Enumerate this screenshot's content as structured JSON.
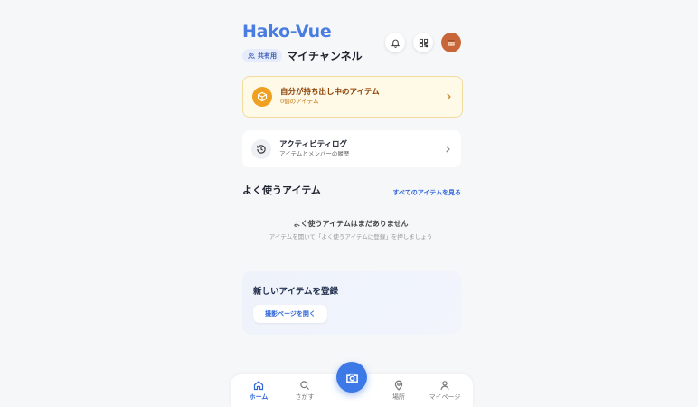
{
  "header": {
    "app_name": "Hako-Vue",
    "shared_badge": "共有用",
    "channel_name": "マイチャンネル"
  },
  "cards": {
    "carry_out": {
      "title": "自分が持ち出し中のアイテム",
      "subtitle": "0個のアイテム"
    },
    "activity_log": {
      "title": "アクティビティログ",
      "subtitle": "アイテムとメンバーの履歴"
    }
  },
  "frequent": {
    "title": "よく使うアイテム",
    "see_all": "すべてのアイテムを見る",
    "empty_title": "よく使うアイテムはまだありません",
    "empty_hint": "アイテムを開いて「よく使うアイテムに登録」を押しましょう"
  },
  "register": {
    "title": "新しいアイテムを登録",
    "button": "撮影ページを開く"
  },
  "tabbar": {
    "items": [
      {
        "label": "ホーム",
        "icon": "home-icon",
        "active": true
      },
      {
        "label": "さがす",
        "icon": "search-icon",
        "active": false
      },
      {
        "label": "場所",
        "icon": "map-pin-icon",
        "active": false
      },
      {
        "label": "マイページ",
        "icon": "user-icon",
        "active": false
      }
    ],
    "camera_icon": "camera-icon"
  },
  "colors": {
    "brand": "#4a7de2",
    "accent": "#2f66d9",
    "carry_card_bg": "#fff9e8",
    "carry_icon": "#f0a020",
    "avatar": "#c8663a"
  }
}
